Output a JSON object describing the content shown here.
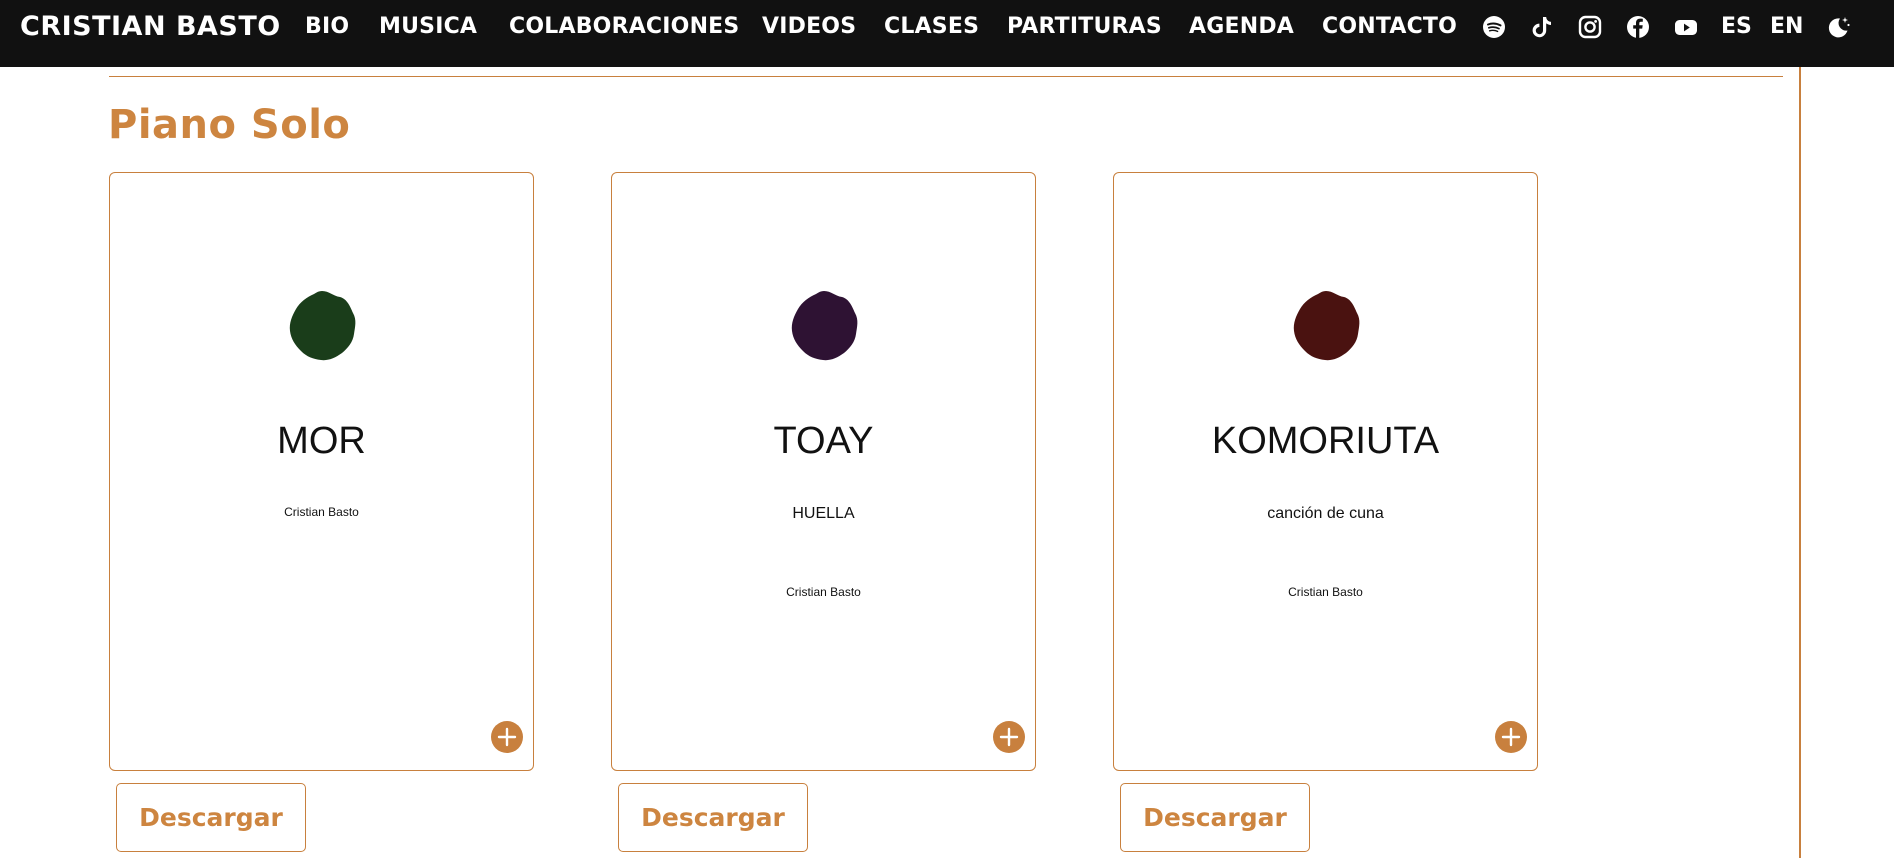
{
  "navbar": {
    "brand": "CRISTIAN BASTO",
    "links": [
      "BIO",
      "MUSICA",
      "COLABORACIONES",
      "VIDEOS",
      "CLASES",
      "PARTITURAS",
      "AGENDA",
      "CONTACTO"
    ],
    "social_icons": [
      "spotify-icon",
      "tiktok-icon",
      "instagram-icon",
      "facebook-icon",
      "youtube-icon"
    ],
    "languages": [
      "ES",
      "EN"
    ],
    "theme_icon": "moon-stars-icon"
  },
  "section": {
    "title": "Piano Solo"
  },
  "cards": [
    {
      "title": "MOR",
      "subtitle": "",
      "author": "Cristian Basto",
      "art_color": "#1a3d1a",
      "art_icon": "ink-blot-icon",
      "plus_icon": "plus-icon",
      "download_label": "Descargar"
    },
    {
      "title": "TOAY",
      "subtitle": "HUELLA",
      "author": "Cristian Basto",
      "art_color": "#2e1233",
      "art_icon": "ink-blot-icon",
      "plus_icon": "plus-icon",
      "download_label": "Descargar"
    },
    {
      "title": "KOMORIUTA",
      "subtitle": "canción de cuna",
      "author": "Cristian Basto",
      "art_color": "#4a1210",
      "art_icon": "ink-blot-icon",
      "plus_icon": "plus-icon",
      "download_label": "Descargar"
    }
  ],
  "colors": {
    "accent": "#c8803e",
    "navbar_bg": "#111111",
    "text": "#111111"
  }
}
